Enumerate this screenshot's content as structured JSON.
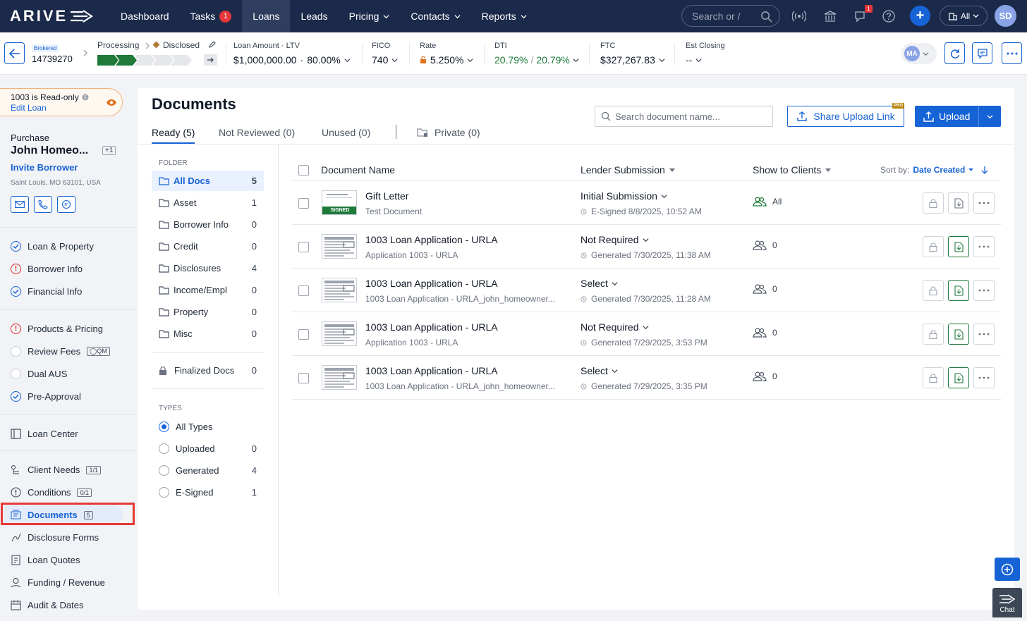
{
  "nav": {
    "logo": "ARIVE",
    "items": [
      {
        "label": "Dashboard"
      },
      {
        "label": "Tasks",
        "badge": "1"
      },
      {
        "label": "Loans",
        "active": true
      },
      {
        "label": "Leads"
      },
      {
        "label": "Pricing",
        "dropdown": true
      },
      {
        "label": "Contacts",
        "dropdown": true
      },
      {
        "label": "Reports",
        "dropdown": true
      }
    ],
    "search_placeholder": "Search or /",
    "notif_badge": "1",
    "company_filter": "All",
    "user_initials": "SD"
  },
  "loan": {
    "tag": "Brokered",
    "number": "14739270",
    "status_from": "Processing",
    "status_to": "Disclosed",
    "progress_filled": 2,
    "progress_total": 5,
    "amount_label": "Loan Amount",
    "ltv_label": "LTV",
    "amount": "$1,000,000.00",
    "ltv": "80.00%",
    "fico_label": "FICO",
    "fico": "740",
    "rate_label": "Rate",
    "rate": "5.250%",
    "dti_label": "DTI",
    "dti_front": "20.79%",
    "dti_sep": "/",
    "dti_back": "20.79%",
    "ftc_label": "FTC",
    "ftc": "$327,267.83",
    "closing_label": "Est Closing",
    "closing": "--",
    "assignee_initials": "MA"
  },
  "sidebar": {
    "readonly_text": "1003 is Read-only",
    "edit_loan": "Edit Loan",
    "purpose": "Purchase",
    "borrower": "John Homeo...",
    "borrower_extra": "+1",
    "invite": "Invite Borrower",
    "address": "Saint Louis, MO 63101, USA",
    "group1": [
      {
        "label": "Loan & Property",
        "status": "check"
      },
      {
        "label": "Borrower Info",
        "status": "warn"
      },
      {
        "label": "Financial Info",
        "status": "check"
      }
    ],
    "group2": [
      {
        "label": "Products & Pricing",
        "status": "warn"
      },
      {
        "label": "Review Fees",
        "status": "empty",
        "tag": "QM"
      },
      {
        "label": "Dual AUS",
        "status": "empty"
      },
      {
        "label": "Pre-Approval",
        "status": "check"
      }
    ],
    "loan_center": "Loan Center",
    "group3": [
      {
        "label": "Client Needs",
        "tag": "1/1",
        "icon": "client-needs-icon"
      },
      {
        "label": "Conditions",
        "tag": "0/1",
        "icon": "conditions-icon"
      },
      {
        "label": "Documents",
        "tag": "5",
        "icon": "documents-icon",
        "active": true
      },
      {
        "label": "Disclosure Forms",
        "icon": "disclosure-icon"
      },
      {
        "label": "Loan Quotes",
        "icon": "quotes-icon"
      },
      {
        "label": "Funding / Revenue",
        "icon": "funding-icon"
      },
      {
        "label": "Audit & Dates",
        "icon": "audit-icon"
      }
    ]
  },
  "documents": {
    "title": "Documents",
    "tabs": [
      {
        "label": "Ready (5)",
        "active": true
      },
      {
        "label": "Not Reviewed (0)"
      },
      {
        "label": "Unused (0)"
      },
      {
        "label": "Private (0)"
      }
    ],
    "search_placeholder": "Search document name...",
    "share_link": "Share Upload Link",
    "pro_tag": "PRO",
    "upload": "Upload",
    "folder_heading": "FOLDER",
    "folders": [
      {
        "name": "All Docs",
        "count": "5",
        "selected": true
      },
      {
        "name": "Asset",
        "count": "1"
      },
      {
        "name": "Borrower Info",
        "count": "0"
      },
      {
        "name": "Credit",
        "count": "0"
      },
      {
        "name": "Disclosures",
        "count": "4"
      },
      {
        "name": "Income/Empl",
        "count": "0"
      },
      {
        "name": "Property",
        "count": "0"
      },
      {
        "name": "Misc",
        "count": "0"
      }
    ],
    "finalized": {
      "name": "Finalized Docs",
      "count": "0"
    },
    "types_heading": "TYPES",
    "types": [
      {
        "name": "All Types",
        "count": "",
        "selected": true
      },
      {
        "name": "Uploaded",
        "count": "0"
      },
      {
        "name": "Generated",
        "count": "4"
      },
      {
        "name": "E-Signed",
        "count": "1"
      }
    ],
    "columns": {
      "name": "Document Name",
      "lender": "Lender Submission",
      "clients": "Show to Clients",
      "sort_label": "Sort by:",
      "sort_value": "Date Created"
    },
    "rows": [
      {
        "name": "Gift Letter",
        "sub": "Test Document",
        "lender": "Initial Submission",
        "status": "E-Signed 8/8/2025, 10:52 AM",
        "clients": "All",
        "signed": "SIGNED",
        "highlight": false
      },
      {
        "name": "1003 Loan Application - URLA",
        "sub": "Application 1003 - URLA",
        "lender": "Not Required",
        "status": "Generated 7/30/2025, 11:38 AM",
        "clients": "0",
        "highlight": true
      },
      {
        "name": "1003 Loan Application - URLA",
        "sub": "1003 Loan Application - URLA_john_homeowner...",
        "lender": "Select",
        "status": "Generated 7/30/2025, 11:28 AM",
        "clients": "0",
        "highlight": true
      },
      {
        "name": "1003 Loan Application - URLA",
        "sub": "Application 1003 - URLA",
        "lender": "Not Required",
        "status": "Generated 7/29/2025, 3:53 PM",
        "clients": "0",
        "highlight": true
      },
      {
        "name": "1003 Loan Application - URLA",
        "sub": "1003 Loan Application - URLA_john_homeowner...",
        "lender": "Select",
        "status": "Generated 7/29/2025, 3:35 PM",
        "clients": "0",
        "highlight": true
      }
    ]
  },
  "chat_label": "Chat",
  "colors": {
    "nav_bg": "#1b2a4a",
    "primary": "#1663d6",
    "success": "#1f7a3a",
    "danger": "#e5353b",
    "annotation": "#e53935"
  }
}
